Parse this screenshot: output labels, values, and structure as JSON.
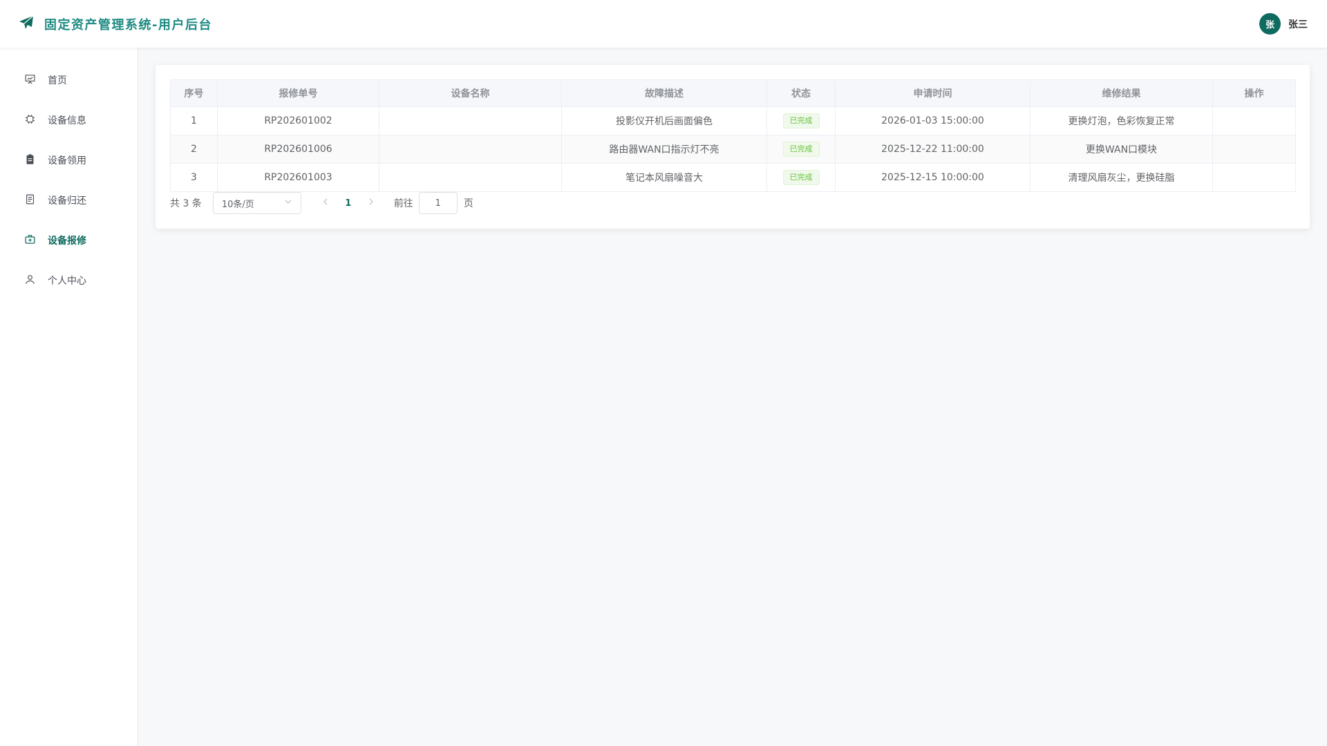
{
  "header": {
    "title": "固定资产管理系统-用户后台",
    "brand_icon": "paper-plane-icon",
    "user": {
      "avatar_text": "张",
      "name": "张三"
    },
    "accent_color": "#1c8a82"
  },
  "sidebar": {
    "items": [
      {
        "label": "首页",
        "icon": "presentation-icon"
      },
      {
        "label": "设备信息",
        "icon": "cpu-icon"
      },
      {
        "label": "设备领用",
        "icon": "clipboard-icon"
      },
      {
        "label": "设备归还",
        "icon": "document-icon"
      },
      {
        "label": "设备报修",
        "icon": "first-aid-kit-icon",
        "active": true
      },
      {
        "label": "个人中心",
        "icon": "user-icon"
      }
    ],
    "active_color": "#0f6b5f"
  },
  "table": {
    "columns": [
      "序号",
      "报修单号",
      "设备名称",
      "故障描述",
      "状态",
      "申请时间",
      "维修结果",
      "操作"
    ],
    "rows": [
      {
        "index": "1",
        "order_no": "RP202601002",
        "device": "",
        "fault": "投影仪开机后画面偏色",
        "status": "已完成",
        "time": "2026-01-03 15:00:00",
        "result": "更换灯泡，色彩恢复正常",
        "action": ""
      },
      {
        "index": "2",
        "order_no": "RP202601006",
        "device": "",
        "fault": "路由器WAN口指示灯不亮",
        "status": "已完成",
        "time": "2025-12-22 11:00:00",
        "result": "更换WAN口模块",
        "action": ""
      },
      {
        "index": "3",
        "order_no": "RP202601003",
        "device": "",
        "fault": "笔记本风扇噪音大",
        "status": "已完成",
        "time": "2025-12-15 10:00:00",
        "result": "清理风扇灰尘，更换硅脂",
        "action": ""
      }
    ],
    "status_color": "#67c23a"
  },
  "pagination": {
    "total": "共 3 条",
    "page_size": "10条/页",
    "current_page": "1",
    "goto_label": "前往",
    "goto_value": "1",
    "page_suffix": "页"
  }
}
